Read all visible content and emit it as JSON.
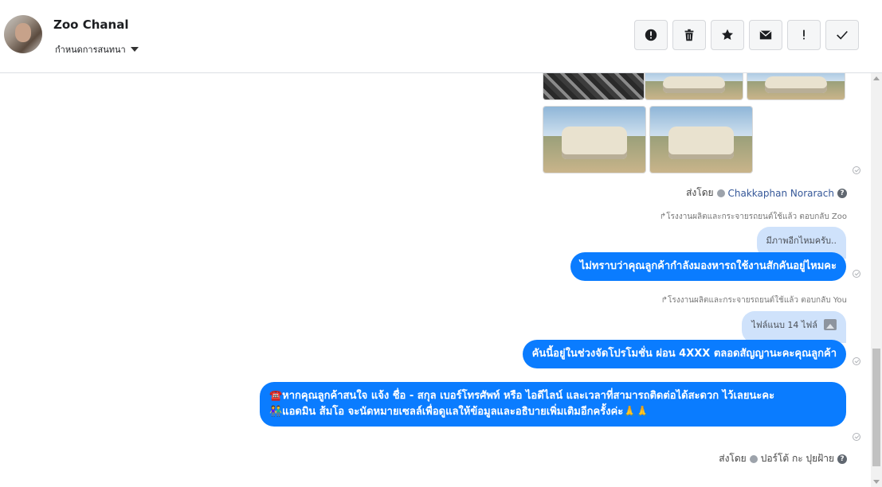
{
  "header": {
    "title": "Zoo Chanal",
    "subtitle": "กำหนดการสนทนา",
    "actions": [
      {
        "name": "report-icon",
        "label": "Report"
      },
      {
        "name": "trash-icon",
        "label": "Delete"
      },
      {
        "name": "star-icon",
        "label": "Star"
      },
      {
        "name": "mail-icon",
        "label": "Mark unread"
      },
      {
        "name": "exclamation-icon",
        "label": "Important"
      },
      {
        "name": "checkmark-icon",
        "label": "Done"
      }
    ]
  },
  "messages": {
    "sent_by_1": {
      "prefix": "ส่งโดย",
      "name": "Chakkaphan Norarach"
    },
    "reply_note_1": "โรงงานผลิตและกระจายรถยนต์ใช้แล้ว ตอบกลับ Zoo",
    "quote_1": "มีภาพอีกไหมครับ..",
    "bubble_1": "ไม่ทราบว่าคุณลูกค้ากำลังมองหารถใช้งานสักคันอยู่ไหมคะ",
    "reply_note_2": "โรงงานผลิตและกระจายรถยนต์ใช้แล้ว ตอบกลับ You",
    "quote_2": "ไฟล์แนบ 14 ไฟล์",
    "bubble_2": "คันนี้อยู่ในช่วงจัดโปรโมชั่น ผ่อน 4XXX ตลอดสัญญานะคะคุณลูกค้า",
    "bubble_3_line1": "☎️หากคุณลูกค้าสนใจ แจ้ง ชื่อ - สกุล เบอร์โทรศัพท์ หรือ ไอดีไลน์ และเวลาที่สามารถติดต่อได้สะดวก ไว้เลยนะคะ",
    "bubble_3_line2": "👫แอดมิน ส้มโอ จะนัดหมายเซลล์เพื่อดูแลให้ข้อมูลและอธิบายเพิ่มเติมอีกครั้งค่ะ🙏🙏",
    "sent_by_2": {
      "prefix": "ส่งโดย",
      "name": "ปอร์โต้ กะ ปุยฝ้าย"
    }
  },
  "colors": {
    "bubble": "#0a7cff",
    "quote": "#cfe2fb",
    "link": "#365899"
  }
}
